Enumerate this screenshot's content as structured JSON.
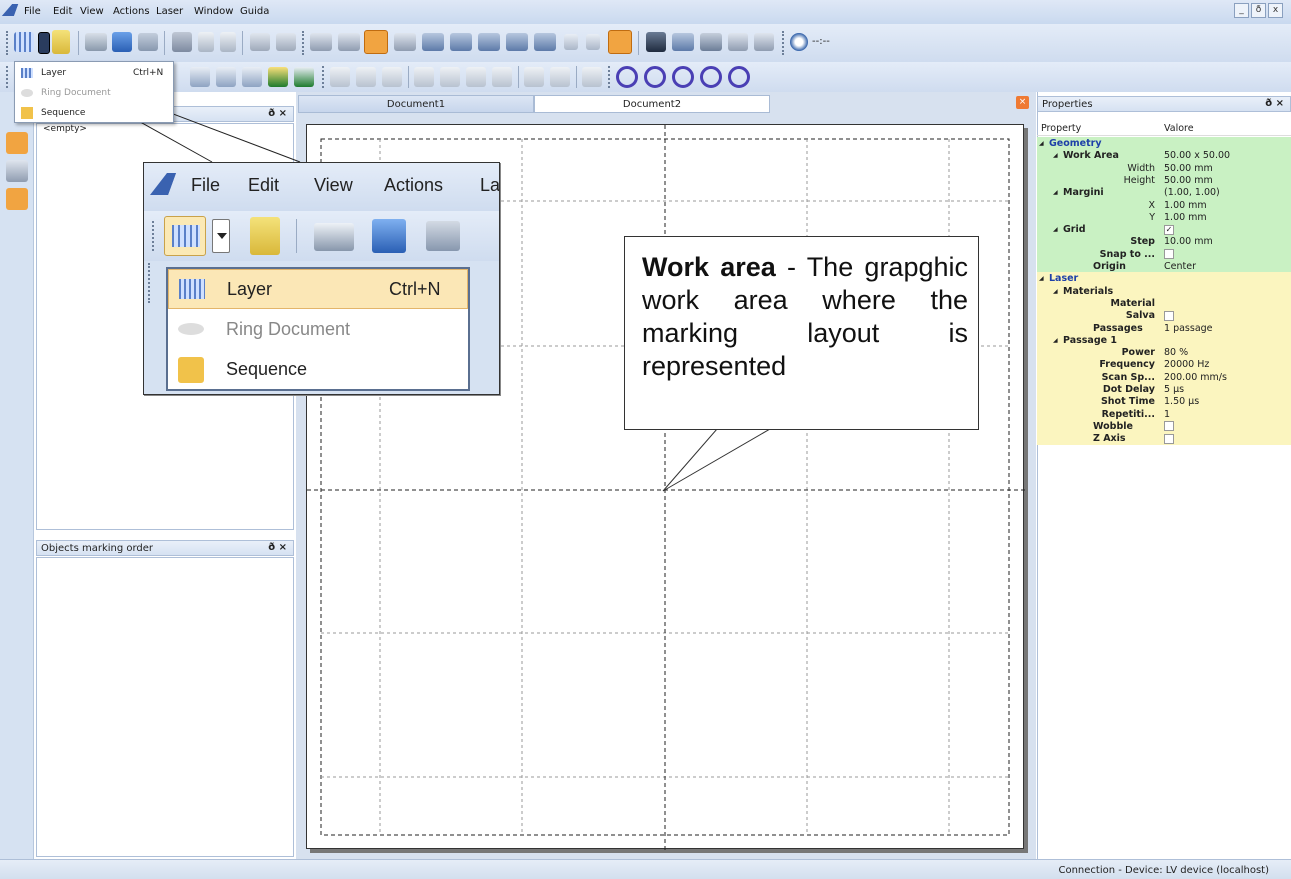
{
  "menu": {
    "items": [
      "File",
      "Edit",
      "View",
      "Actions",
      "Laser",
      "Window",
      "Guida"
    ]
  },
  "window_controls": {
    "minimize": "_",
    "restore": "ð",
    "close": "x"
  },
  "timer": {
    "label": "--:--"
  },
  "layer_dropdown": {
    "items": [
      {
        "label": "Layer",
        "shortcut": "Ctrl+N",
        "enabled": true
      },
      {
        "label": "Ring Document",
        "shortcut": "",
        "enabled": false
      },
      {
        "label": "Sequence",
        "shortcut": "",
        "enabled": true
      }
    ]
  },
  "layers_panel": {
    "content": "<empty>"
  },
  "marking_order_panel": {
    "title": "Objects marking order"
  },
  "tabs": [
    {
      "label": "Document1"
    },
    {
      "label": "Document2"
    }
  ],
  "zoom_menu": [
    "File",
    "Edit",
    "View",
    "Actions",
    "La"
  ],
  "callout": {
    "bold": "Work area",
    "text": " - The grapghic work area where the marking layout is represented"
  },
  "properties": {
    "title": "Properties",
    "col_property": "Property",
    "col_value": "Valore",
    "rows": [
      {
        "name": "Geometry",
        "value": "",
        "kind": "section"
      },
      {
        "name": "Work Area",
        "value": "50.00 x 50.00",
        "kind": "bold-group"
      },
      {
        "name": "Width",
        "value": "50.00 mm",
        "kind": "sub"
      },
      {
        "name": "Height",
        "value": "50.00 mm",
        "kind": "sub"
      },
      {
        "name": "Margini",
        "value": "(1.00, 1.00)",
        "kind": "bold-group"
      },
      {
        "name": "X",
        "value": "1.00 mm",
        "kind": "sub"
      },
      {
        "name": "Y",
        "value": "1.00 mm",
        "kind": "sub"
      },
      {
        "name": "Grid",
        "value": "",
        "kind": "bold-group",
        "checked": true
      },
      {
        "name": "Step",
        "value": "10.00 mm",
        "kind": "bold-sub"
      },
      {
        "name": "Snap to ...",
        "value": "",
        "kind": "bold-sub",
        "checked": false
      },
      {
        "name": "Origin",
        "value": "Center",
        "kind": "bold-leaf"
      },
      {
        "name": "Laser",
        "value": "",
        "kind": "section"
      },
      {
        "name": "Materials",
        "value": "",
        "kind": "bold-group"
      },
      {
        "name": "Material",
        "value": "",
        "kind": "bold-sub"
      },
      {
        "name": "Salva",
        "value": "",
        "kind": "bold-sub",
        "checked": false
      },
      {
        "name": "Passages",
        "value": "1 passage",
        "kind": "bold-leaf"
      },
      {
        "name": "Passage 1",
        "value": "",
        "kind": "bold-group"
      },
      {
        "name": "Power",
        "value": "80 %",
        "kind": "bold-sub"
      },
      {
        "name": "Frequency",
        "value": "20000 Hz",
        "kind": "bold-sub"
      },
      {
        "name": "Scan Sp...",
        "value": "200.00 mm/s",
        "kind": "bold-sub"
      },
      {
        "name": "Dot Delay",
        "value": "5 µs",
        "kind": "bold-sub"
      },
      {
        "name": "Shot Time",
        "value": "1.50 µs",
        "kind": "bold-sub"
      },
      {
        "name": "Repetiti...",
        "value": "1",
        "kind": "bold-sub"
      },
      {
        "name": "Wobble",
        "value": "",
        "kind": "bold-leaf",
        "checked": false
      },
      {
        "name": "Z Axis",
        "value": "",
        "kind": "bold-leaf",
        "checked": false
      }
    ]
  },
  "status": {
    "text": "Connection - Device: LV device (localhost)"
  }
}
